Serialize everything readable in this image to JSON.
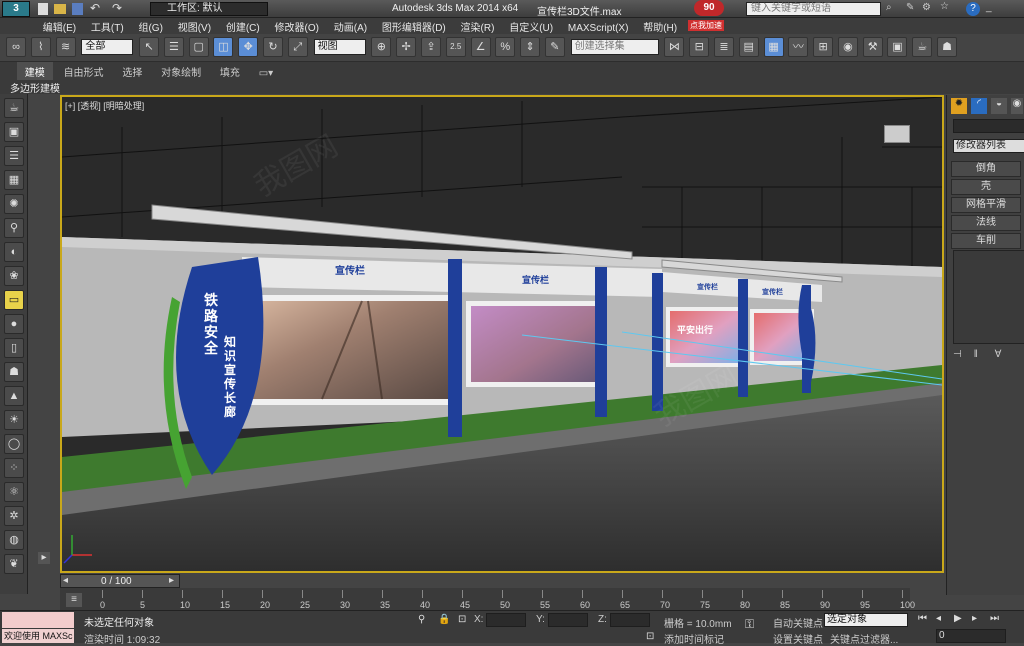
{
  "title": {
    "workspace_label": "工作区: 默认",
    "app_title": "Autodesk 3ds Max  2014 x64",
    "file_name": "宣传栏3D文件.max",
    "search_placeholder": "键入关键字或短语",
    "badge_count": "90",
    "badge_text": "点我加速"
  },
  "menu": [
    "编辑(E)",
    "工具(T)",
    "组(G)",
    "视图(V)",
    "创建(C)",
    "修改器(O)",
    "动画(A)",
    "图形编辑器(D)",
    "渲染(R)",
    "自定义(U)",
    "MAXScript(X)",
    "帮助(H)"
  ],
  "toolbar": {
    "filter_value": "全部",
    "refcoord_value": "视图",
    "snap_value": "2.5",
    "selection_set_placeholder": "创建选择集"
  },
  "ribbon": {
    "tabs": [
      "建模",
      "自由形式",
      "选择",
      "对象绘制",
      "填充"
    ],
    "subtab": "多边形建模"
  },
  "viewport": {
    "label": "[+] [透视] [明暗处理]",
    "sign_title_1": "宣传栏",
    "sign_title_2": "宣传栏",
    "sign_title_3": "宣传栏",
    "sign_title_4": "宣传栏",
    "vertical_top": "铁路安全",
    "vertical_main": "知识宣传长廊",
    "poster_text": "平安出行"
  },
  "cmdpanel": {
    "modifier_list": "修改器列表",
    "buttons": [
      "倒角",
      "壳",
      "网格平滑",
      "法线",
      "车削"
    ]
  },
  "timeline": {
    "frame_display": "0 / 100",
    "ticks": [
      "0",
      "5",
      "10",
      "15",
      "20",
      "25",
      "30",
      "35",
      "40",
      "45",
      "50",
      "55",
      "60",
      "65",
      "70",
      "75",
      "80",
      "85",
      "90",
      "95",
      "100"
    ]
  },
  "status": {
    "welcome": "欢迎使用 MAXSc",
    "selection_status": "未选定任何对象",
    "render_time": "渲染时间 1:09:32",
    "x_label": "X:",
    "y_label": "Y:",
    "z_label": "Z:",
    "grid": "栅格 = 10.0mm",
    "add_time_tag": "添加时间标记",
    "auto_key": "自动关键点",
    "set_key": "设置关键点",
    "selected_dropdown": "选定对象",
    "key_filters": "关键点过滤器...",
    "frame_value": "0"
  },
  "colors": {
    "viewport_border": "#c9a81a",
    "sign_blue": "#1f3f9a",
    "post_blue": "#1f3f9a"
  }
}
